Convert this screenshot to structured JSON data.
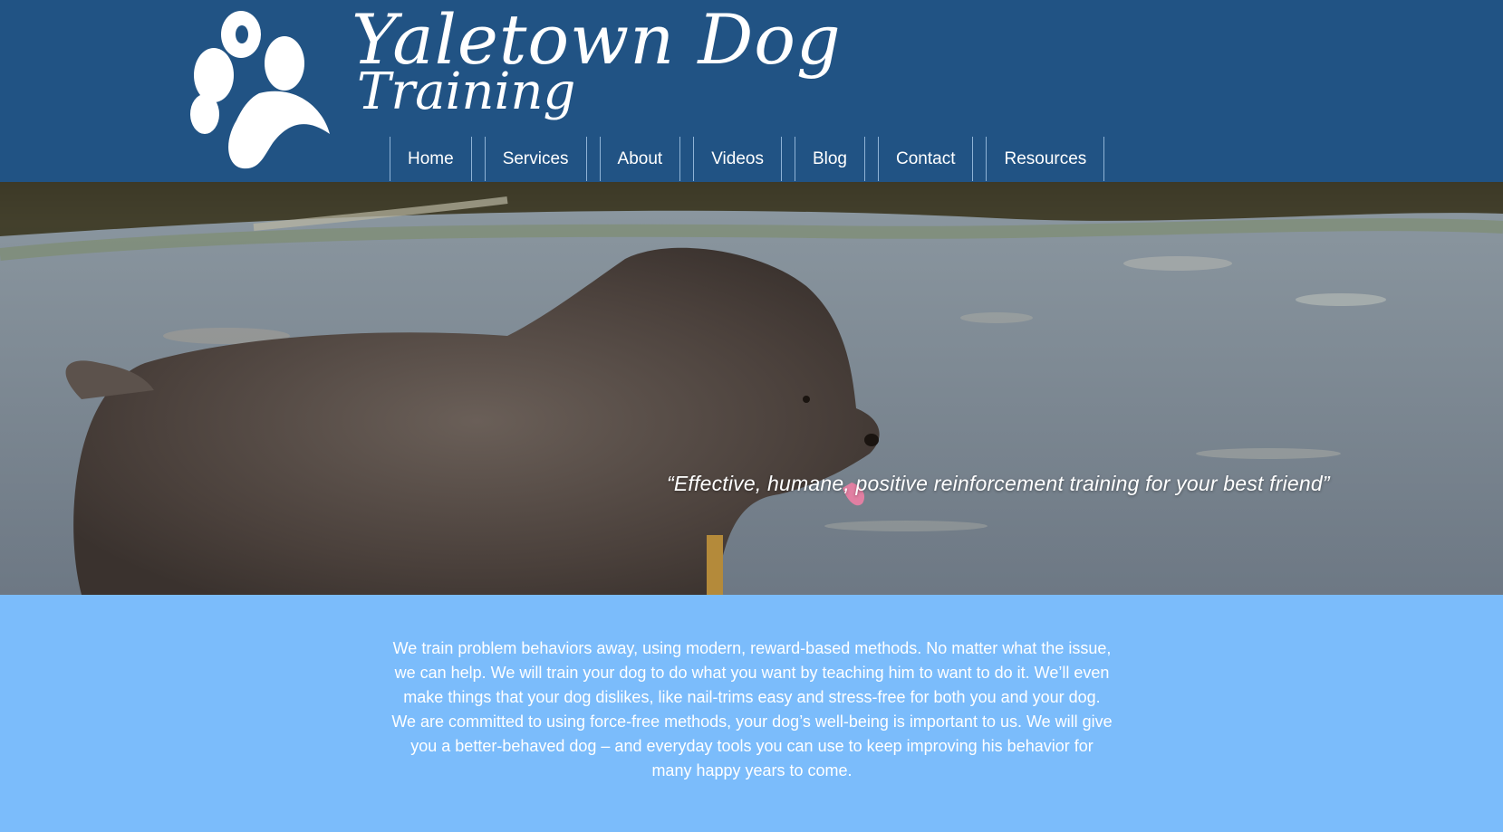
{
  "site": {
    "logo_line1": "Yaletown Dog",
    "logo_line2": "Training"
  },
  "nav": {
    "items": [
      {
        "label": "Home"
      },
      {
        "label": "Services"
      },
      {
        "label": "About"
      },
      {
        "label": "Videos"
      },
      {
        "label": "Blog"
      },
      {
        "label": "Contact"
      },
      {
        "label": "Resources"
      }
    ]
  },
  "hero": {
    "tagline": "“Effective, humane, positive reinforcement training for your best friend”"
  },
  "intro": {
    "text": "We train problem behaviors away, using modern, reward-based methods. No matter what the issue, we can help. We will train your dog to do what you want by teaching him to want to do it. We’ll even make things that your dog dislikes, like nail-trims easy and stress-free for both you and your dog. We are committed to using force-free methods, your dog’s well-being is important to us. We will give you a better-behaved dog – and everyday tools you can use to keep improving his behavior for many happy years to come."
  },
  "colors": {
    "header_bg": "#215384",
    "body_bg": "#7bbcfb",
    "text": "#ffffff"
  },
  "icons": {
    "logo": "paw-print-icon"
  }
}
